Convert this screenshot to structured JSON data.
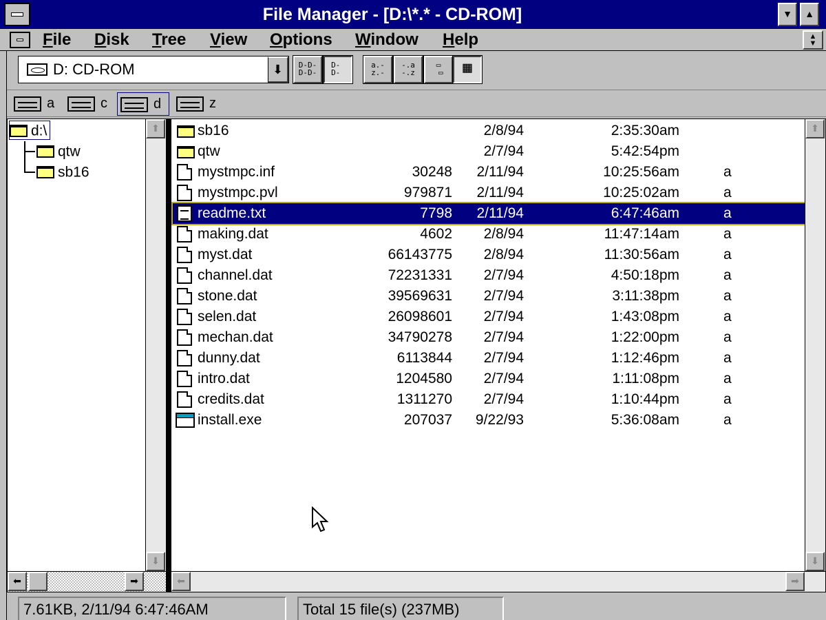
{
  "window": {
    "title": "File Manager - [D:\\*.* - CD-ROM]",
    "minimize_glyph": "▼",
    "maximize_glyph": "▲"
  },
  "menu": {
    "items": [
      "File",
      "Disk",
      "Tree",
      "View",
      "Options",
      "Window",
      "Help"
    ],
    "restore_glyph": "▲\n▼"
  },
  "toolbar": {
    "drive_combo_value": "D: CD-ROM",
    "drive_combo_arrow": "⬇",
    "buttons": [
      {
        "name": "view-by-name-button",
        "icon": "name-view-icon",
        "glyph": "D-D-\nD-D-"
      },
      {
        "name": "view-all-details-button",
        "icon": "details-view-icon",
        "glyph": "D- \nD- "
      },
      {
        "name": "sort-by-name-button",
        "icon": "sort-name-icon",
        "glyph": "a.-\nz.-"
      },
      {
        "name": "sort-by-type-button",
        "icon": "sort-type-icon",
        "glyph": "-.a\n-.z"
      },
      {
        "name": "new-window-button",
        "icon": "new-window-icon",
        "glyph": "▭\n ▭"
      },
      {
        "name": "save-settings-button",
        "icon": "save-settings-icon",
        "glyph": "▦"
      }
    ]
  },
  "drives": [
    {
      "letter": "a",
      "icon": "floppy-drive-icon",
      "selected": false
    },
    {
      "letter": "c",
      "icon": "hard-drive-icon",
      "selected": false
    },
    {
      "letter": "d",
      "icon": "cdrom-drive-icon",
      "selected": true
    },
    {
      "letter": "z",
      "icon": "network-drive-icon",
      "selected": false
    }
  ],
  "tree": {
    "root": "d:\\",
    "children": [
      "qtw",
      "sb16"
    ]
  },
  "scroll": {
    "up": "⬆",
    "down": "⬇",
    "left": "⬅",
    "right": "➡"
  },
  "files": [
    {
      "name": "sb16",
      "size": "",
      "date": "2/8/94",
      "time": "2:35:30am",
      "attr": "",
      "icon": "folder-icon",
      "kind": "folder",
      "selected": false
    },
    {
      "name": "qtw",
      "size": "",
      "date": "2/7/94",
      "time": "5:42:54pm",
      "attr": "",
      "icon": "folder-icon",
      "kind": "folder",
      "selected": false
    },
    {
      "name": "mystmpc.inf",
      "size": "30248",
      "date": "2/11/94",
      "time": "10:25:56am",
      "attr": "a",
      "icon": "document-icon",
      "kind": "doc",
      "selected": false
    },
    {
      "name": "mystmpc.pvl",
      "size": "979871",
      "date": "2/11/94",
      "time": "10:25:02am",
      "attr": "a",
      "icon": "document-icon",
      "kind": "doc",
      "selected": false
    },
    {
      "name": "readme.txt",
      "size": "7798",
      "date": "2/11/94",
      "time": "6:47:46am",
      "attr": "a",
      "icon": "text-file-icon",
      "kind": "text",
      "selected": true
    },
    {
      "name": "making.dat",
      "size": "4602",
      "date": "2/8/94",
      "time": "11:47:14am",
      "attr": "a",
      "icon": "document-icon",
      "kind": "doc",
      "selected": false
    },
    {
      "name": "myst.dat",
      "size": "66143775",
      "date": "2/8/94",
      "time": "11:30:56am",
      "attr": "a",
      "icon": "document-icon",
      "kind": "doc",
      "selected": false
    },
    {
      "name": "channel.dat",
      "size": "72231331",
      "date": "2/7/94",
      "time": "4:50:18pm",
      "attr": "a",
      "icon": "document-icon",
      "kind": "doc",
      "selected": false
    },
    {
      "name": "stone.dat",
      "size": "39569631",
      "date": "2/7/94",
      "time": "3:11:38pm",
      "attr": "a",
      "icon": "document-icon",
      "kind": "doc",
      "selected": false
    },
    {
      "name": "selen.dat",
      "size": "26098601",
      "date": "2/7/94",
      "time": "1:43:08pm",
      "attr": "a",
      "icon": "document-icon",
      "kind": "doc",
      "selected": false
    },
    {
      "name": "mechan.dat",
      "size": "34790278",
      "date": "2/7/94",
      "time": "1:22:00pm",
      "attr": "a",
      "icon": "document-icon",
      "kind": "doc",
      "selected": false
    },
    {
      "name": "dunny.dat",
      "size": "6113844",
      "date": "2/7/94",
      "time": "1:12:46pm",
      "attr": "a",
      "icon": "document-icon",
      "kind": "doc",
      "selected": false
    },
    {
      "name": "intro.dat",
      "size": "1204580",
      "date": "2/7/94",
      "time": "1:11:08pm",
      "attr": "a",
      "icon": "document-icon",
      "kind": "doc",
      "selected": false
    },
    {
      "name": "credits.dat",
      "size": "1311270",
      "date": "2/7/94",
      "time": "1:10:44pm",
      "attr": "a",
      "icon": "document-icon",
      "kind": "doc",
      "selected": false
    },
    {
      "name": "install.exe",
      "size": "207037",
      "date": "9/22/93",
      "time": "5:36:08am",
      "attr": "a",
      "icon": "application-icon",
      "kind": "exe",
      "selected": false
    }
  ],
  "status": {
    "selection": "7.61KB, 2/11/94 6:47:46AM",
    "total": "Total 15 file(s) (237MB)"
  },
  "colors": {
    "title_bar": "#000080",
    "selection": "#000080",
    "face": "#c0c0c0",
    "folder": "#ffff80"
  }
}
